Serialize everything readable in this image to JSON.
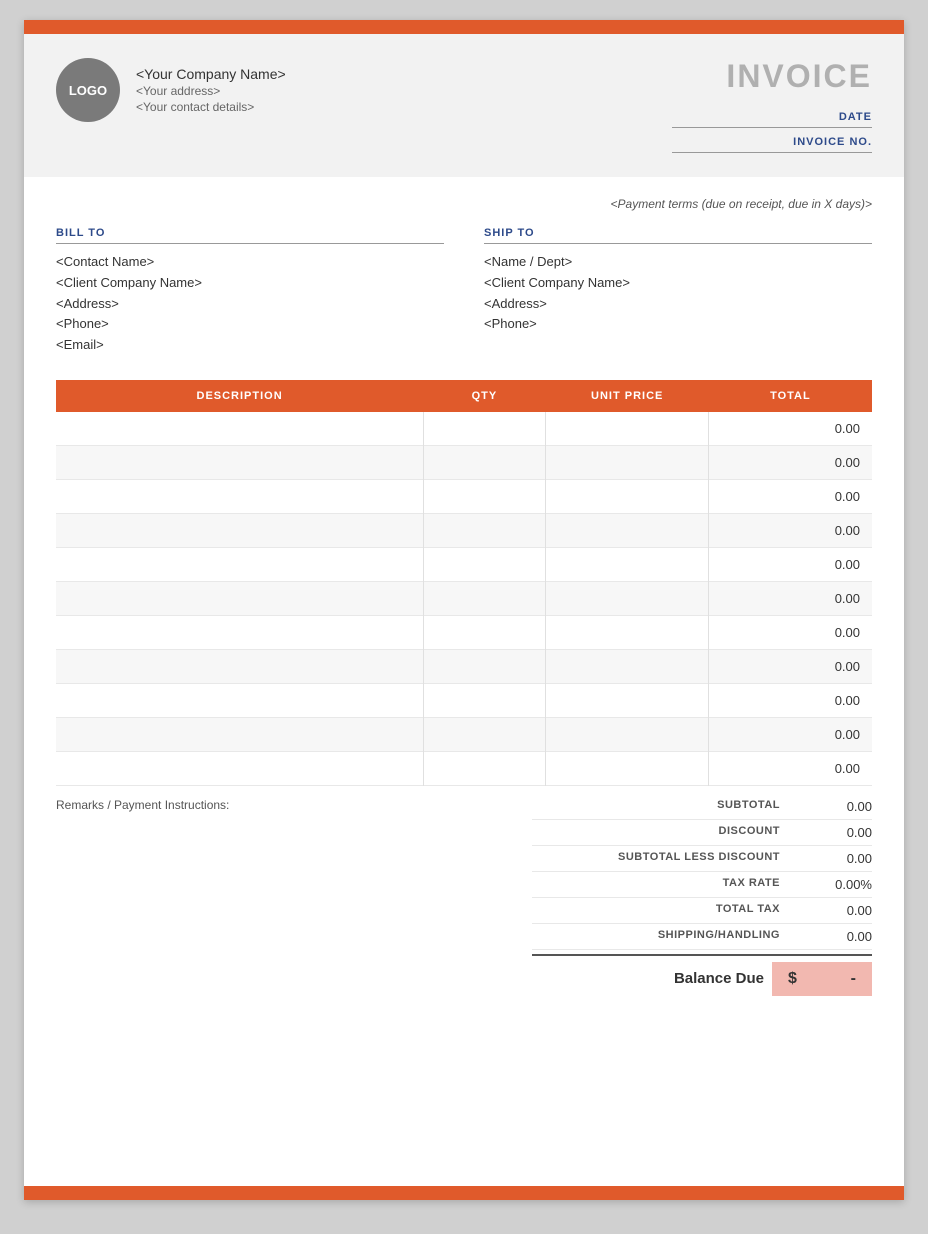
{
  "top_bar": {
    "color": "#e05a2b"
  },
  "header": {
    "logo_text": "LOGO",
    "company_name": "<Your Company Name>",
    "company_address": "<Your address>",
    "company_contact": "<Your contact details>",
    "invoice_title": "INVOICE",
    "date_label": "DATE",
    "invoice_no_label": "INVOICE NO."
  },
  "payment_terms": "<Payment terms (due on receipt, due in X days)>",
  "bill_to": {
    "label": "BILL TO",
    "contact_name": "<Contact Name>",
    "company_name": "<Client Company Name>",
    "address": "<Address>",
    "phone": "<Phone>",
    "email": "<Email>"
  },
  "ship_to": {
    "label": "SHIP TO",
    "name_dept": "<Name / Dept>",
    "company_name": "<Client Company Name>",
    "address": "<Address>",
    "phone": "<Phone>"
  },
  "table": {
    "headers": {
      "description": "DESCRIPTION",
      "qty": "QTY",
      "unit_price": "UNIT PRICE",
      "total": "TOTAL"
    },
    "rows": [
      {
        "description": "",
        "qty": "",
        "unit_price": "",
        "total": "0.00"
      },
      {
        "description": "",
        "qty": "",
        "unit_price": "",
        "total": "0.00"
      },
      {
        "description": "",
        "qty": "",
        "unit_price": "",
        "total": "0.00"
      },
      {
        "description": "",
        "qty": "",
        "unit_price": "",
        "total": "0.00"
      },
      {
        "description": "",
        "qty": "",
        "unit_price": "",
        "total": "0.00"
      },
      {
        "description": "",
        "qty": "",
        "unit_price": "",
        "total": "0.00"
      },
      {
        "description": "",
        "qty": "",
        "unit_price": "",
        "total": "0.00"
      },
      {
        "description": "",
        "qty": "",
        "unit_price": "",
        "total": "0.00"
      },
      {
        "description": "",
        "qty": "",
        "unit_price": "",
        "total": "0.00"
      },
      {
        "description": "",
        "qty": "",
        "unit_price": "",
        "total": "0.00"
      },
      {
        "description": "",
        "qty": "",
        "unit_price": "",
        "total": "0.00"
      }
    ]
  },
  "remarks_label": "Remarks / Payment Instructions:",
  "totals": {
    "subtotal_label": "SUBTOTAL",
    "subtotal_value": "0.00",
    "discount_label": "DISCOUNT",
    "discount_value": "0.00",
    "subtotal_less_discount_label": "SUBTOTAL LESS DISCOUNT",
    "subtotal_less_discount_value": "0.00",
    "tax_rate_label": "TAX RATE",
    "tax_rate_value": "0.00%",
    "total_tax_label": "TOTAL TAX",
    "total_tax_value": "0.00",
    "shipping_handling_label": "SHIPPING/HANDLING",
    "shipping_handling_value": "0.00",
    "balance_due_label": "Balance Due",
    "balance_currency_symbol": "$",
    "balance_due_value": "-"
  }
}
